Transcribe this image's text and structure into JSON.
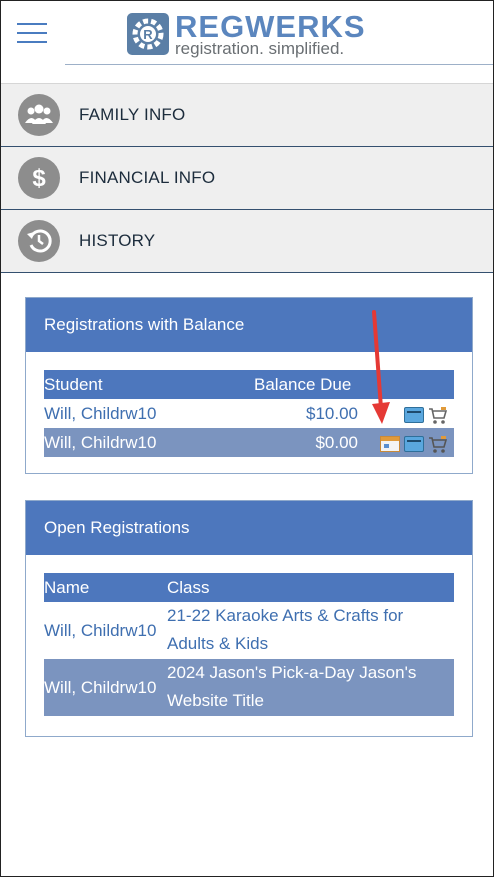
{
  "header": {
    "menu_icon": "hamburger-icon",
    "logo": {
      "title": "REGWERKS",
      "subtitle": "registration. simplified."
    }
  },
  "nav": [
    {
      "label": "FAMILY INFO",
      "icon": "family-icon"
    },
    {
      "label": "FINANCIAL INFO",
      "icon": "dollar-icon"
    },
    {
      "label": "HISTORY",
      "icon": "history-icon"
    }
  ],
  "balance_panel": {
    "title": "Registrations with Balance",
    "columns": {
      "student": "Student",
      "balance": "Balance Due"
    },
    "rows": [
      {
        "student": "Will, Childrw10",
        "balance": "$10.00",
        "icons": [
          "credit-card-icon",
          "cart-icon"
        ]
      },
      {
        "student": "Will, Childrw10",
        "balance": "$0.00",
        "icons": [
          "calendar-icon",
          "credit-card-icon",
          "cart-icon"
        ]
      }
    ]
  },
  "open_panel": {
    "title": "Open Registrations",
    "columns": {
      "name": "Name",
      "class": "Class"
    },
    "rows": [
      {
        "name": "Will, Childrw10",
        "class_line1": "21-22 Karaoke Arts & Crafts for",
        "class_line2": "Adults & Kids"
      },
      {
        "name": "Will, Childrw10",
        "class_line1": "2024 Jason's Pick-a-Day Jason's",
        "class_line2": "Website Title"
      }
    ]
  },
  "annotation": {
    "color": "#e53935",
    "icon": "red-arrow-annotation"
  }
}
